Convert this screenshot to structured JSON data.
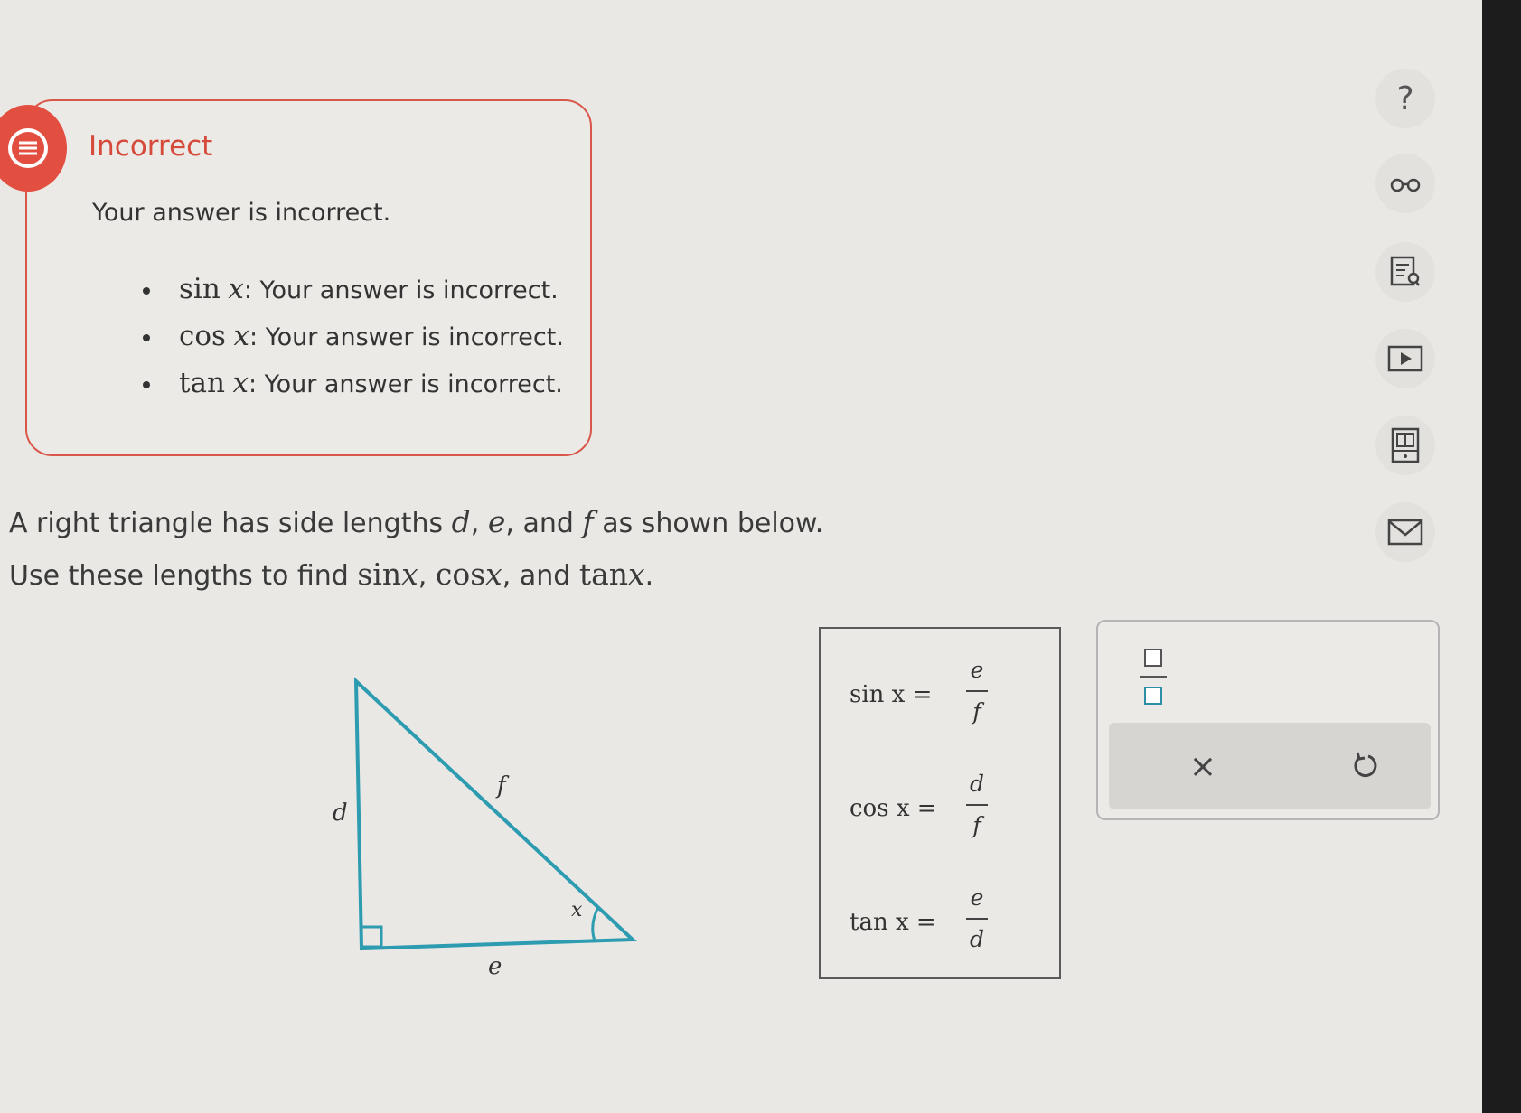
{
  "feedback": {
    "title": "Incorrect",
    "message": "Your answer is incorrect.",
    "items": [
      {
        "fn": "sin",
        "var": "x",
        "text": ": Your answer is incorrect."
      },
      {
        "fn": "cos",
        "var": "x",
        "text": ": Your answer is incorrect."
      },
      {
        "fn": "tan",
        "var": "x",
        "text": ": Your answer is incorrect."
      }
    ],
    "accent": "#e24e3f"
  },
  "question": {
    "line1_a": "A right triangle has side lengths ",
    "d": "d",
    "sep1": ", ",
    "e": "e",
    "sep2": ", and ",
    "f": "f",
    "line1_b": " as shown below.",
    "line2_a": "Use these lengths to find ",
    "sin": "sin",
    "cos": "cos",
    "tan": "tan",
    "x": "x",
    "comma": ",",
    "and": ", and ",
    "period": "."
  },
  "triangle": {
    "side_vertical": "d",
    "side_bottom": "e",
    "hypotenuse": "f",
    "angle": "x",
    "color": "#2d9bb0"
  },
  "answers": [
    {
      "lhs": "sin x  =",
      "num": "e",
      "den": "f"
    },
    {
      "lhs": "cos x  =",
      "num": "d",
      "den": "f"
    },
    {
      "lhs": "tan x  =",
      "num": "e",
      "den": "d"
    }
  ],
  "palette": {
    "clear_icon": "×",
    "undo_icon": "undo-icon"
  },
  "side": {
    "help_label": "?"
  }
}
